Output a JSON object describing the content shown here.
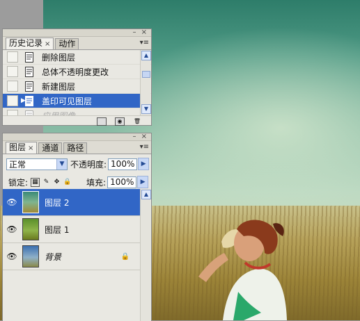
{
  "history": {
    "tabs": [
      {
        "label": "历史记录",
        "close": "×"
      },
      {
        "label": "动作"
      }
    ],
    "items": [
      {
        "label": "删除图层"
      },
      {
        "label": "总体不透明度更改"
      },
      {
        "label": "新建图层"
      },
      {
        "label": "盖印可见图层",
        "selected": true
      },
      {
        "label": "应用图像",
        "dimmed": true
      }
    ]
  },
  "layers": {
    "tabs": [
      {
        "label": "图层",
        "close": "×"
      },
      {
        "label": "通道"
      },
      {
        "label": "路径"
      }
    ],
    "blend_mode": "正常",
    "opacity_label": "不透明度:",
    "opacity_value": "100%",
    "lock_label": "锁定:",
    "fill_label": "填充:",
    "fill_value": "100%",
    "items": [
      {
        "name": "图层 2",
        "selected": true
      },
      {
        "name": "图层 1"
      },
      {
        "name": "背景",
        "locked": true
      }
    ]
  },
  "colors": {
    "selection": "#3166c6",
    "panel_bg": "#e9e8e2"
  }
}
